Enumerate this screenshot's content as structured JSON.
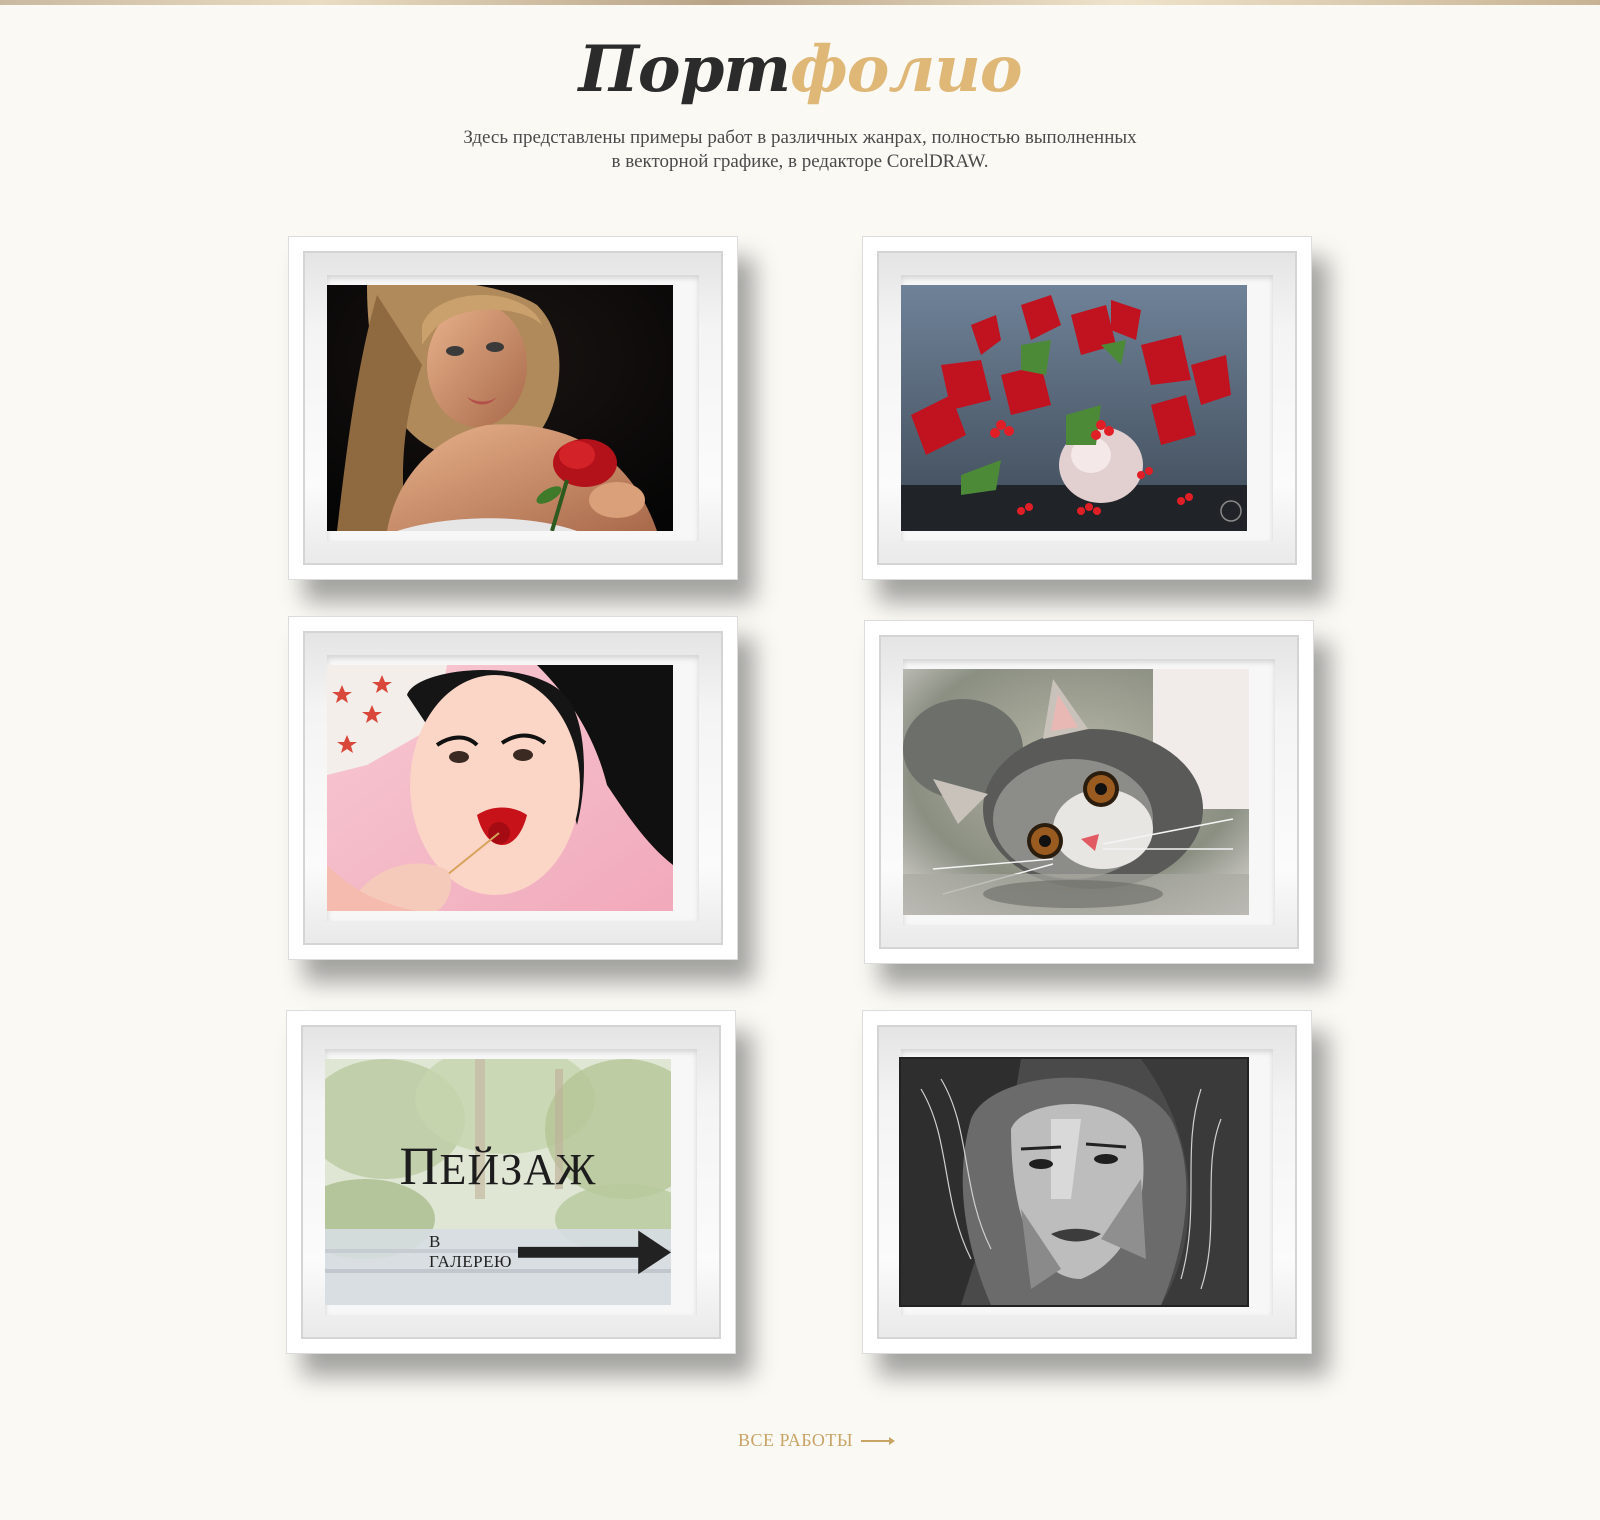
{
  "section": {
    "title_part1": "Порт",
    "title_part2": "фолио",
    "subtitle_line1": "Здесь представлены примеры работ в различных жанрах, полностью выполненных",
    "subtitle_line2": "в векторной графике, в редакторе CorelDRAW."
  },
  "gallery": {
    "items": [
      {
        "subject": "woman-with-rose"
      },
      {
        "subject": "viburnum-still-life"
      },
      {
        "subject": "girl-with-cherry"
      },
      {
        "subject": "kitten"
      },
      {
        "subject": "landscape",
        "title_cap": "П",
        "title_rest": "ейзаж",
        "link_label": "В ГАЛЕРЕЮ"
      },
      {
        "subject": "bw-portrait"
      }
    ]
  },
  "footer_link": {
    "label": "ВСЕ РАБОТЫ"
  },
  "colors": {
    "background": "#faf9f4",
    "title_dark": "#2b2b2b",
    "title_accent": "#dfb878",
    "link_accent": "#c9a467"
  }
}
